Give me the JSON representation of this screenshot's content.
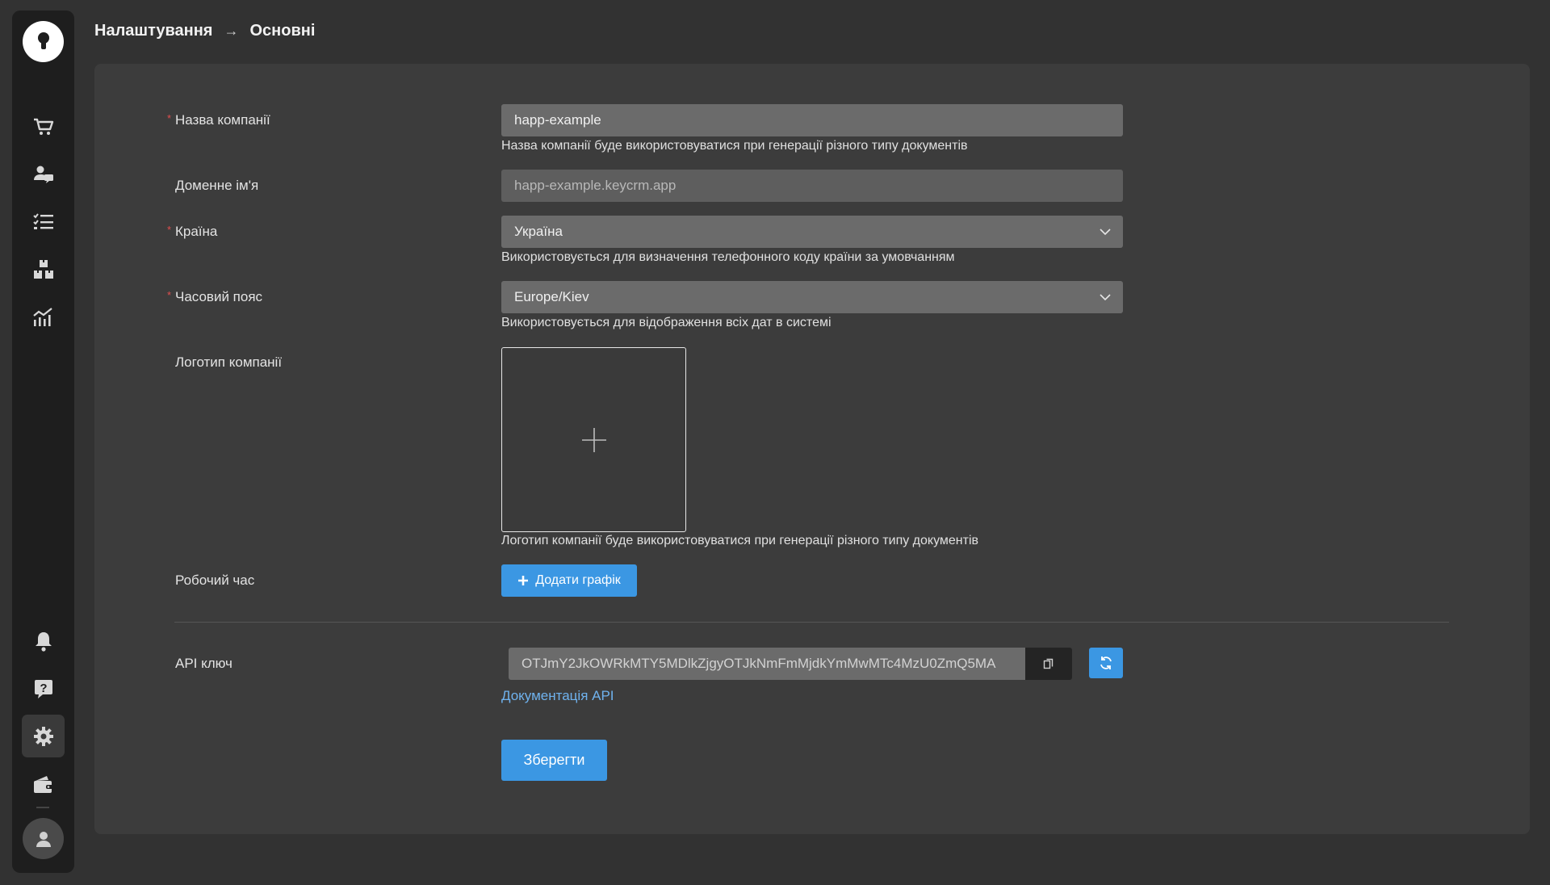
{
  "breadcrumb": {
    "parent": "Налаштування",
    "separator": "→",
    "current": "Основні"
  },
  "sidebar": {
    "items": [
      {
        "name": "cart-icon"
      },
      {
        "name": "customers-icon"
      },
      {
        "name": "tasks-icon"
      },
      {
        "name": "warehouse-icon"
      },
      {
        "name": "analytics-icon"
      },
      {
        "name": "bell-icon"
      },
      {
        "name": "help-icon"
      },
      {
        "name": "gear-icon",
        "active": true
      },
      {
        "name": "wallet-icon"
      }
    ]
  },
  "form": {
    "company_name": {
      "label": "Назва компанії",
      "required": "*",
      "value": "happ-example",
      "hint": "Назва компанії буде використовуватися при генерації різного типу документів"
    },
    "domain": {
      "label": "Доменне ім'я",
      "value": "happ-example.keycrm.app"
    },
    "country": {
      "label": "Країна",
      "required": "*",
      "value": "Україна",
      "hint": "Використовується для визначення телефонного коду країни за умовчанням"
    },
    "timezone": {
      "label": "Часовий пояс",
      "required": "*",
      "value": "Europe/Kiev",
      "hint": "Використовується для відображення всіх дат в системі"
    },
    "logo": {
      "label": "Логотип компанії",
      "hint": "Логотип компанії буде використовуватися при генерації різного типу документів"
    },
    "work_hours": {
      "label": "Робочий час",
      "button": "Додати графік"
    },
    "api": {
      "label": "API ключ",
      "value": "OTJmY2JkOWRkMTY5MDlkZjgyOTJkNmFmMjdkYmMwMTc4MzU0ZmQ5MA",
      "docs_link": "Документація API"
    },
    "save_label": "Зберегти"
  },
  "colors": {
    "accent": "#3b97e3",
    "required": "#e04e4e",
    "link": "#6fb2ee"
  }
}
